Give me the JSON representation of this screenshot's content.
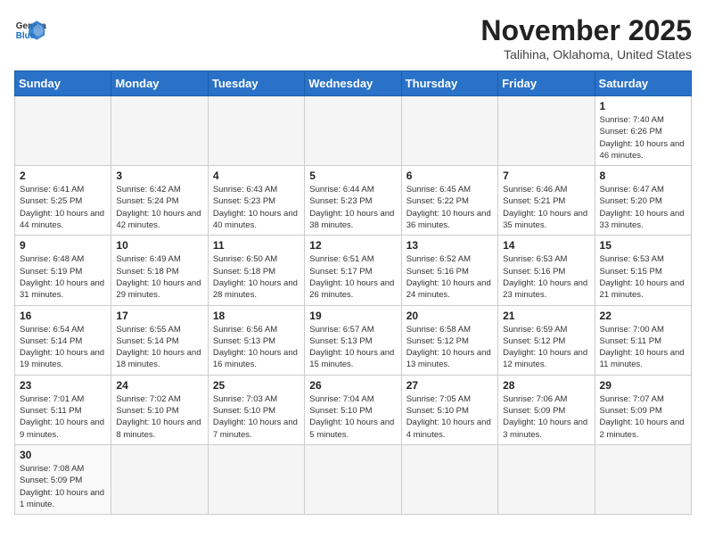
{
  "header": {
    "logo_general": "General",
    "logo_blue": "Blue",
    "month": "November 2025",
    "location": "Talihina, Oklahoma, United States"
  },
  "weekdays": [
    "Sunday",
    "Monday",
    "Tuesday",
    "Wednesday",
    "Thursday",
    "Friday",
    "Saturday"
  ],
  "weeks": [
    [
      {
        "day": "",
        "info": ""
      },
      {
        "day": "",
        "info": ""
      },
      {
        "day": "",
        "info": ""
      },
      {
        "day": "",
        "info": ""
      },
      {
        "day": "",
        "info": ""
      },
      {
        "day": "",
        "info": ""
      },
      {
        "day": "1",
        "info": "Sunrise: 7:40 AM\nSunset: 6:26 PM\nDaylight: 10 hours and 46 minutes."
      }
    ],
    [
      {
        "day": "2",
        "info": "Sunrise: 6:41 AM\nSunset: 5:25 PM\nDaylight: 10 hours and 44 minutes."
      },
      {
        "day": "3",
        "info": "Sunrise: 6:42 AM\nSunset: 5:24 PM\nDaylight: 10 hours and 42 minutes."
      },
      {
        "day": "4",
        "info": "Sunrise: 6:43 AM\nSunset: 5:23 PM\nDaylight: 10 hours and 40 minutes."
      },
      {
        "day": "5",
        "info": "Sunrise: 6:44 AM\nSunset: 5:23 PM\nDaylight: 10 hours and 38 minutes."
      },
      {
        "day": "6",
        "info": "Sunrise: 6:45 AM\nSunset: 5:22 PM\nDaylight: 10 hours and 36 minutes."
      },
      {
        "day": "7",
        "info": "Sunrise: 6:46 AM\nSunset: 5:21 PM\nDaylight: 10 hours and 35 minutes."
      },
      {
        "day": "8",
        "info": "Sunrise: 6:47 AM\nSunset: 5:20 PM\nDaylight: 10 hours and 33 minutes."
      }
    ],
    [
      {
        "day": "9",
        "info": "Sunrise: 6:48 AM\nSunset: 5:19 PM\nDaylight: 10 hours and 31 minutes."
      },
      {
        "day": "10",
        "info": "Sunrise: 6:49 AM\nSunset: 5:18 PM\nDaylight: 10 hours and 29 minutes."
      },
      {
        "day": "11",
        "info": "Sunrise: 6:50 AM\nSunset: 5:18 PM\nDaylight: 10 hours and 28 minutes."
      },
      {
        "day": "12",
        "info": "Sunrise: 6:51 AM\nSunset: 5:17 PM\nDaylight: 10 hours and 26 minutes."
      },
      {
        "day": "13",
        "info": "Sunrise: 6:52 AM\nSunset: 5:16 PM\nDaylight: 10 hours and 24 minutes."
      },
      {
        "day": "14",
        "info": "Sunrise: 6:53 AM\nSunset: 5:16 PM\nDaylight: 10 hours and 23 minutes."
      },
      {
        "day": "15",
        "info": "Sunrise: 6:53 AM\nSunset: 5:15 PM\nDaylight: 10 hours and 21 minutes."
      }
    ],
    [
      {
        "day": "16",
        "info": "Sunrise: 6:54 AM\nSunset: 5:14 PM\nDaylight: 10 hours and 19 minutes."
      },
      {
        "day": "17",
        "info": "Sunrise: 6:55 AM\nSunset: 5:14 PM\nDaylight: 10 hours and 18 minutes."
      },
      {
        "day": "18",
        "info": "Sunrise: 6:56 AM\nSunset: 5:13 PM\nDaylight: 10 hours and 16 minutes."
      },
      {
        "day": "19",
        "info": "Sunrise: 6:57 AM\nSunset: 5:13 PM\nDaylight: 10 hours and 15 minutes."
      },
      {
        "day": "20",
        "info": "Sunrise: 6:58 AM\nSunset: 5:12 PM\nDaylight: 10 hours and 13 minutes."
      },
      {
        "day": "21",
        "info": "Sunrise: 6:59 AM\nSunset: 5:12 PM\nDaylight: 10 hours and 12 minutes."
      },
      {
        "day": "22",
        "info": "Sunrise: 7:00 AM\nSunset: 5:11 PM\nDaylight: 10 hours and 11 minutes."
      }
    ],
    [
      {
        "day": "23",
        "info": "Sunrise: 7:01 AM\nSunset: 5:11 PM\nDaylight: 10 hours and 9 minutes."
      },
      {
        "day": "24",
        "info": "Sunrise: 7:02 AM\nSunset: 5:10 PM\nDaylight: 10 hours and 8 minutes."
      },
      {
        "day": "25",
        "info": "Sunrise: 7:03 AM\nSunset: 5:10 PM\nDaylight: 10 hours and 7 minutes."
      },
      {
        "day": "26",
        "info": "Sunrise: 7:04 AM\nSunset: 5:10 PM\nDaylight: 10 hours and 5 minutes."
      },
      {
        "day": "27",
        "info": "Sunrise: 7:05 AM\nSunset: 5:10 PM\nDaylight: 10 hours and 4 minutes."
      },
      {
        "day": "28",
        "info": "Sunrise: 7:06 AM\nSunset: 5:09 PM\nDaylight: 10 hours and 3 minutes."
      },
      {
        "day": "29",
        "info": "Sunrise: 7:07 AM\nSunset: 5:09 PM\nDaylight: 10 hours and 2 minutes."
      }
    ],
    [
      {
        "day": "30",
        "info": "Sunrise: 7:08 AM\nSunset: 5:09 PM\nDaylight: 10 hours and 1 minute."
      },
      {
        "day": "",
        "info": ""
      },
      {
        "day": "",
        "info": ""
      },
      {
        "day": "",
        "info": ""
      },
      {
        "day": "",
        "info": ""
      },
      {
        "day": "",
        "info": ""
      },
      {
        "day": "",
        "info": ""
      }
    ]
  ]
}
